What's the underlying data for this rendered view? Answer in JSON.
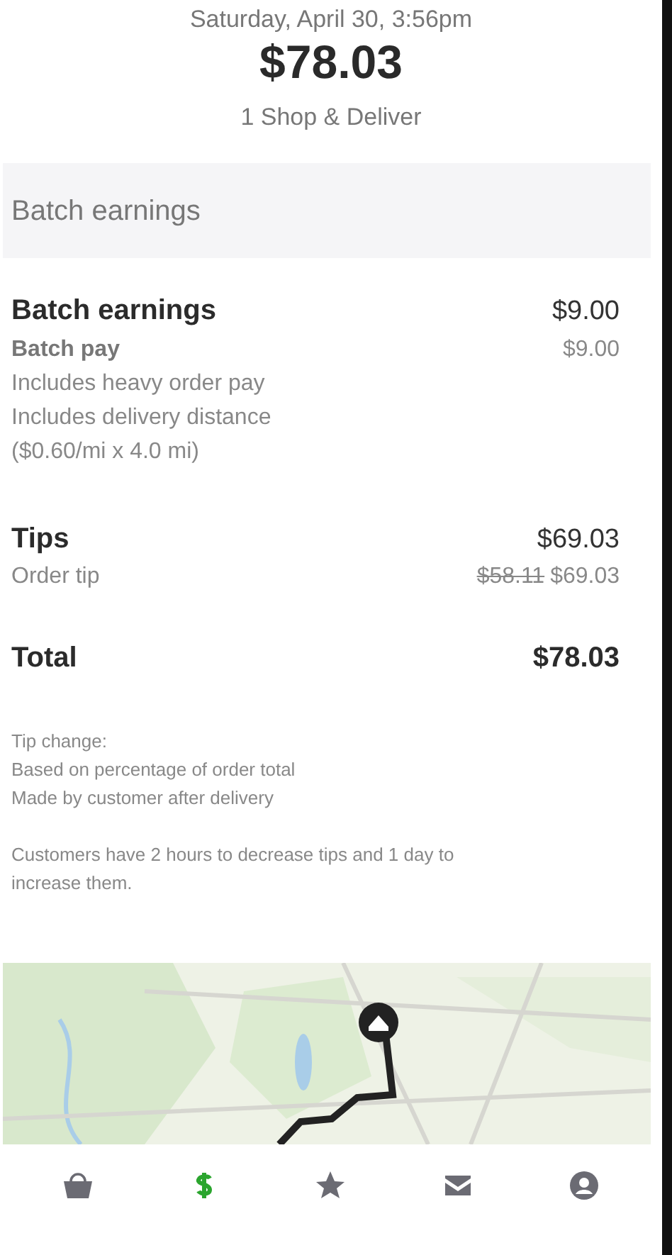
{
  "header": {
    "date": "Saturday, April 30, 3:56pm",
    "amount": "$78.03",
    "subtitle": "1 Shop & Deliver"
  },
  "section_title": "Batch earnings",
  "groups": [
    {
      "title": "Batch earnings",
      "amount": "$9.00",
      "lines": [
        {
          "label": "Batch pay",
          "amount": "$9.00",
          "kind": "subhead"
        },
        {
          "label": "Includes heavy order pay",
          "kind": "note"
        },
        {
          "label": "Includes delivery distance",
          "kind": "note"
        },
        {
          "label": "($0.60/mi x 4.0 mi)",
          "kind": "note"
        }
      ]
    },
    {
      "title": "Tips",
      "amount": "$69.03",
      "lines": [
        {
          "label": "Order tip",
          "previous_amount": "$58.11",
          "amount": "$69.03",
          "kind": "detail"
        }
      ]
    }
  ],
  "total": {
    "label": "Total",
    "amount": "$78.03"
  },
  "tip_change": {
    "title": "Tip change:",
    "lines": [
      "Based on percentage of order total",
      "Made by customer after delivery"
    ]
  },
  "tip_policy": "Customers have 2 hours to decrease tips and 1 day to increase them.",
  "nav": [
    {
      "kind": "bag",
      "selected": false
    },
    {
      "kind": "dollar",
      "selected": true
    },
    {
      "kind": "star",
      "selected": false
    },
    {
      "kind": "mail",
      "selected": false
    },
    {
      "kind": "account",
      "selected": false
    }
  ]
}
